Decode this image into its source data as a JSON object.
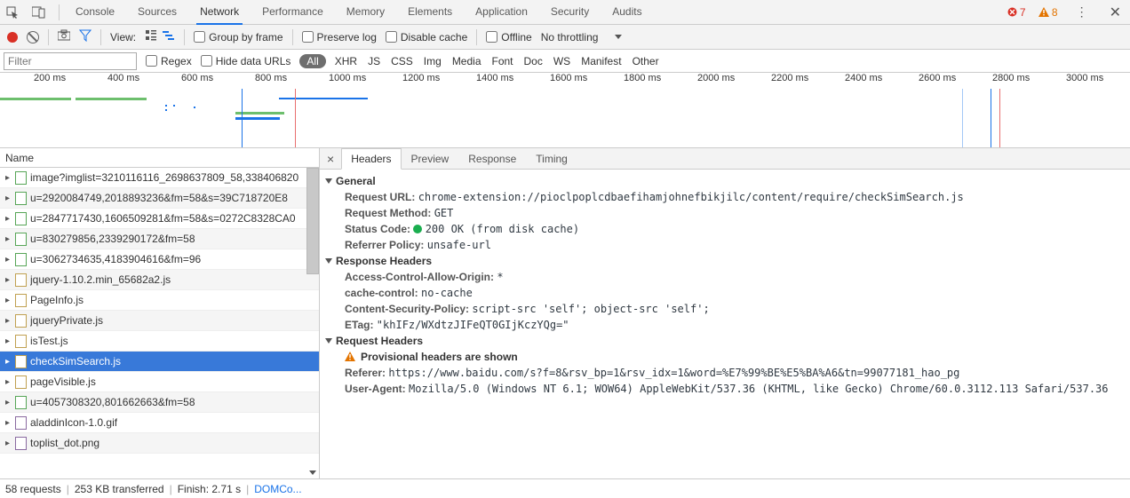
{
  "tabs": {
    "items": [
      "Console",
      "Sources",
      "Network",
      "Performance",
      "Memory",
      "Elements",
      "Application",
      "Security",
      "Audits"
    ],
    "active_index": 2,
    "error_count": "7",
    "warn_count": "8"
  },
  "toolbar": {
    "view_label": "View:",
    "group_by_frame": "Group by frame",
    "preserve_log": "Preserve log",
    "disable_cache": "Disable cache",
    "offline": "Offline",
    "no_throttling": "No throttling"
  },
  "filter": {
    "placeholder": "Filter",
    "regex": "Regex",
    "hide_data_urls": "Hide data URLs",
    "all": "All",
    "types": [
      "XHR",
      "JS",
      "CSS",
      "Img",
      "Media",
      "Font",
      "Doc",
      "WS",
      "Manifest",
      "Other"
    ]
  },
  "timeline": {
    "ticks": [
      "200 ms",
      "400 ms",
      "600 ms",
      "800 ms",
      "1000 ms",
      "1200 ms",
      "1400 ms",
      "1600 ms",
      "1800 ms",
      "2000 ms",
      "2200 ms",
      "2400 ms",
      "2600 ms",
      "2800 ms",
      "3000 ms"
    ]
  },
  "request_list": {
    "header": "Name",
    "rows": [
      {
        "type": "green",
        "text": "image?imglist=3210116116_2698637809_58,338406820"
      },
      {
        "type": "green",
        "text": "u=2920084749,2018893236&fm=58&s=39C718720E8"
      },
      {
        "type": "green",
        "text": "u=2847717430,1606509281&fm=58&s=0272C8328CA0"
      },
      {
        "type": "green",
        "text": "u=830279856,2339290172&fm=58"
      },
      {
        "type": "green",
        "text": "u=3062734635,4183904616&fm=96"
      },
      {
        "type": "js",
        "text": "jquery-1.10.2.min_65682a2.js"
      },
      {
        "type": "js",
        "text": "PageInfo.js"
      },
      {
        "type": "js",
        "text": "jqueryPrivate.js"
      },
      {
        "type": "js",
        "text": "isTest.js"
      },
      {
        "type": "js",
        "text": "checkSimSearch.js",
        "selected": true
      },
      {
        "type": "js",
        "text": "pageVisible.js"
      },
      {
        "type": "green",
        "text": "u=4057308320,801662663&fm=58"
      },
      {
        "type": "purple",
        "text": "aladdinIcon-1.0.gif"
      },
      {
        "type": "purple",
        "text": "toplist_dot.png"
      }
    ]
  },
  "detail": {
    "tabs": [
      "Headers",
      "Preview",
      "Response",
      "Timing"
    ],
    "active_index": 0,
    "general_label": "General",
    "request_url_k": "Request URL:",
    "request_url_v": "chrome-extension://pioclpoplcdbaefihamjohnefbikjilc/content/require/checkSimSearch.js",
    "request_method_k": "Request Method:",
    "request_method_v": "GET",
    "status_code_k": "Status Code:",
    "status_code_v": "200 OK (from disk cache)",
    "referrer_policy_k": "Referrer Policy:",
    "referrer_policy_v": "unsafe-url",
    "response_headers_label": "Response Headers",
    "acao_k": "Access-Control-Allow-Origin:",
    "acao_v": "*",
    "cache_control_k": "cache-control:",
    "cache_control_v": "no-cache",
    "csp_k": "Content-Security-Policy:",
    "csp_v": "script-src 'self'; object-src 'self';",
    "etag_k": "ETag:",
    "etag_v": "\"khIFz/WXdtzJIFeQT0GIjKczYQg=\"",
    "request_headers_label": "Request Headers",
    "provisional": "Provisional headers are shown",
    "referer_k": "Referer:",
    "referer_v": "https://www.baidu.com/s?f=8&rsv_bp=1&rsv_idx=1&word=%E7%99%BE%E5%BA%A6&tn=99077181_hao_pg",
    "ua_k": "User-Agent:",
    "ua_v": "Mozilla/5.0 (Windows NT 6.1; WOW64) AppleWebKit/537.36 (KHTML, like Gecko) Chrome/60.0.3112.113 Safari/537.36"
  },
  "footer": {
    "requests": "58 requests",
    "transferred": "253 KB transferred",
    "finish": "Finish: 2.71 s",
    "domco": "DOMCo..."
  }
}
